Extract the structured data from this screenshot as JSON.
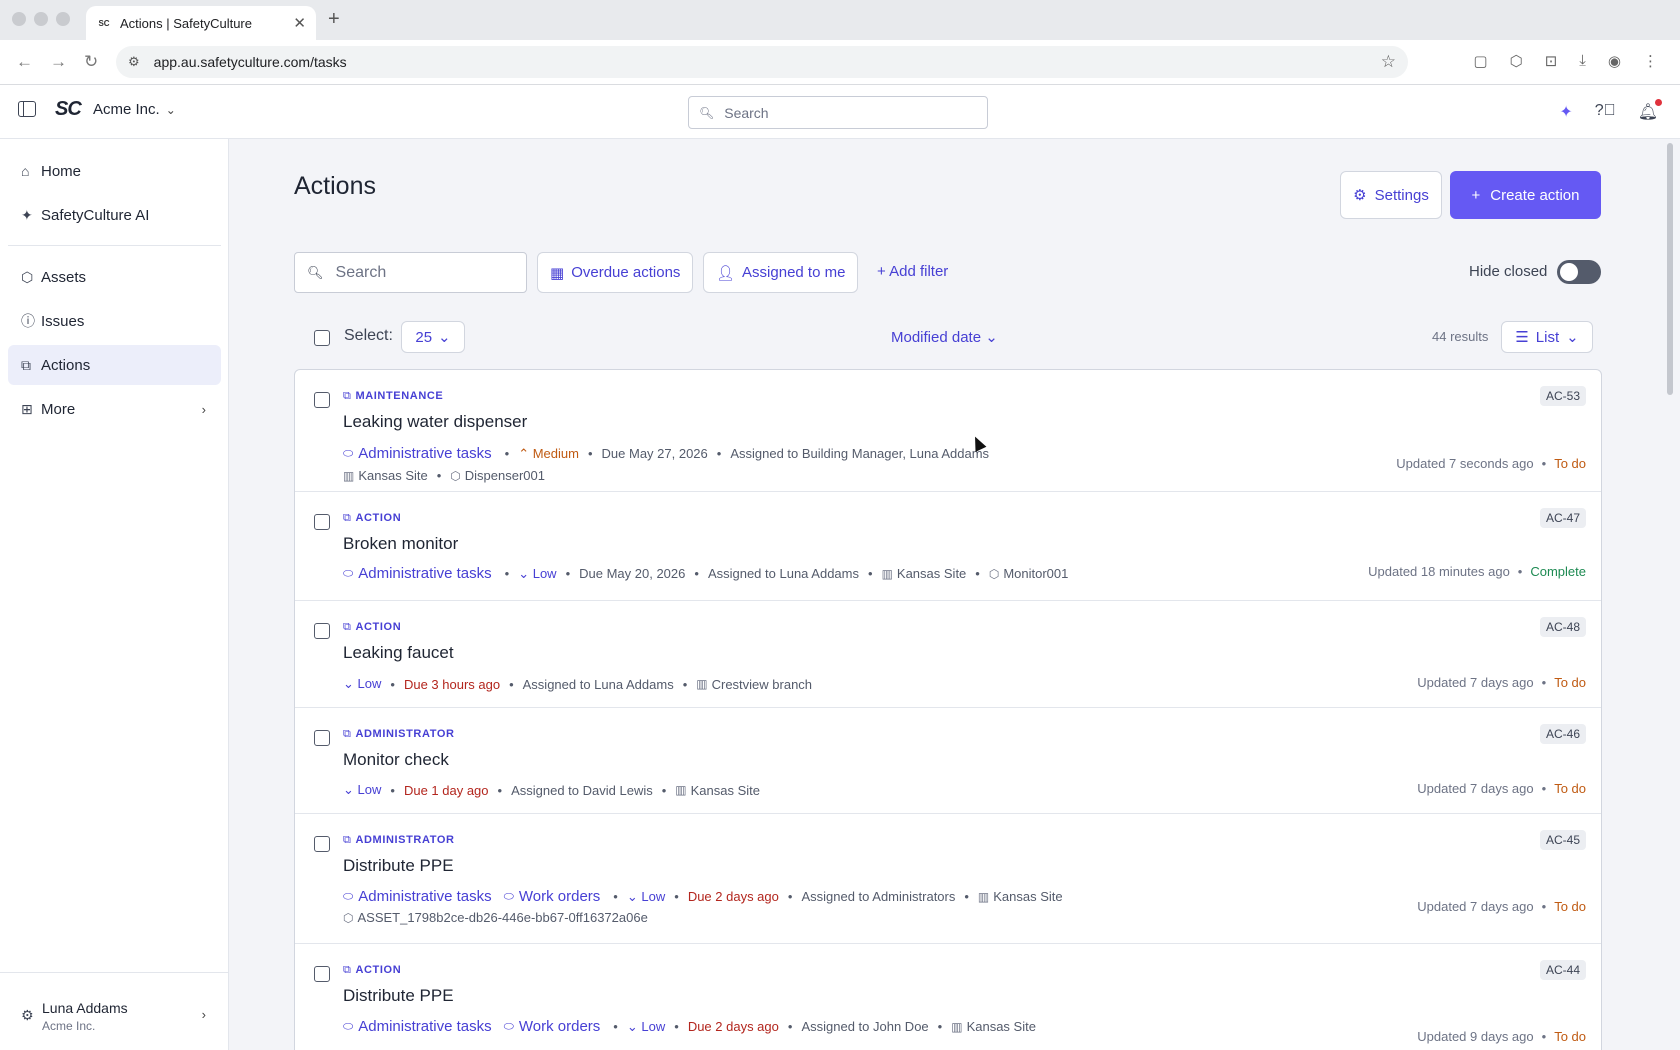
{
  "browser": {
    "tab_title": "Actions | SafetyCulture",
    "favicon": "SC",
    "url": "app.au.safetyculture.com/tasks"
  },
  "header": {
    "logo": "SC",
    "org_name": "Acme Inc.",
    "search_placeholder": "Search"
  },
  "sidebar": {
    "items": [
      {
        "label": "Home",
        "icon": "home-icon"
      },
      {
        "label": "SafetyCulture AI",
        "icon": "sparkle-icon"
      },
      {
        "label": "Assets",
        "icon": "cube-icon"
      },
      {
        "label": "Issues",
        "icon": "alert-icon"
      },
      {
        "label": "Actions",
        "icon": "actions-icon"
      },
      {
        "label": "More",
        "icon": "grid-icon"
      }
    ],
    "user": {
      "name": "Luna Addams",
      "org": "Acme Inc."
    }
  },
  "page": {
    "title": "Actions",
    "settings_label": "Settings",
    "create_label": "Create action",
    "search_placeholder": "Search",
    "filters": {
      "overdue": "Overdue actions",
      "assigned": "Assigned to me",
      "add_filter": "Add filter"
    },
    "hide_closed": "Hide closed",
    "select_label": "Select:",
    "page_size": "25",
    "sort": "Modified date",
    "results": "44 results",
    "view": "List"
  },
  "actions": [
    {
      "type": "MAINTENANCE",
      "title": "Leaking water dispenser",
      "ref": "AC-53",
      "labels": [
        "Administrative tasks"
      ],
      "priority": "Medium",
      "due": "Due May 27, 2026",
      "assigned": "Assigned to Building Manager, Luna Addams",
      "site": "Kansas Site",
      "asset": "Dispenser001",
      "updated": "Updated 7 seconds ago",
      "status": "To do"
    },
    {
      "type": "ACTION",
      "title": "Broken monitor",
      "ref": "AC-47",
      "labels": [
        "Administrative tasks"
      ],
      "priority": "Low",
      "due": "Due May 20, 2026",
      "assigned": "Assigned to Luna Addams",
      "site": "Kansas Site",
      "asset": "Monitor001",
      "updated": "Updated 18 minutes ago",
      "status": "Complete"
    },
    {
      "type": "ACTION",
      "title": "Leaking faucet",
      "ref": "AC-48",
      "priority": "Low",
      "due": "Due 3 hours ago",
      "assigned": "Assigned to Luna Addams",
      "site": "Crestview branch",
      "updated": "Updated 7 days ago",
      "status": "To do"
    },
    {
      "type": "ADMINISTRATOR",
      "title": "Monitor check",
      "ref": "AC-46",
      "priority": "Low",
      "due": "Due 1 day ago",
      "assigned": "Assigned to David Lewis",
      "site": "Kansas Site",
      "updated": "Updated 7 days ago",
      "status": "To do"
    },
    {
      "type": "ADMINISTRATOR",
      "title": "Distribute PPE",
      "ref": "AC-45",
      "labels": [
        "Administrative tasks",
        "Work orders"
      ],
      "priority": "Low",
      "due": "Due 2 days ago",
      "assigned": "Assigned to Administrators",
      "site": "Kansas Site",
      "asset": "ASSET_1798b2ce-db26-446e-bb67-0ff16372a06e",
      "updated": "Updated 7 days ago",
      "status": "To do"
    },
    {
      "type": "ACTION",
      "title": "Distribute PPE",
      "ref": "AC-44",
      "labels": [
        "Administrative tasks",
        "Work orders"
      ],
      "priority": "Low",
      "due": "Due 2 days ago",
      "assigned": "Assigned to John Doe",
      "site": "Kansas Site",
      "updated": "Updated 9 days ago",
      "status": "To do"
    }
  ]
}
